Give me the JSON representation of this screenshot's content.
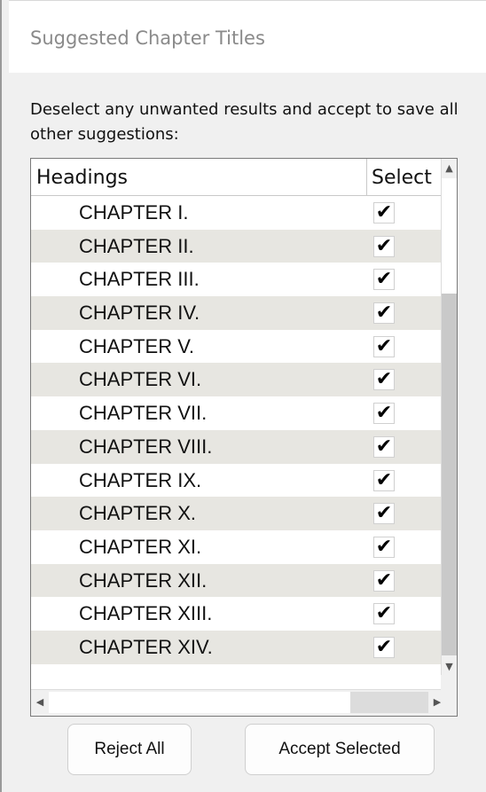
{
  "window": {
    "title": "Suggested Chapter Titles"
  },
  "instructions": "Deselect any unwanted results and accept to save all other suggestions:",
  "table": {
    "columns": {
      "headings": "Headings",
      "select": "Select"
    },
    "rows": [
      {
        "label": "CHAPTER I.",
        "checked": true
      },
      {
        "label": "CHAPTER II.",
        "checked": true
      },
      {
        "label": "CHAPTER III.",
        "checked": true
      },
      {
        "label": "CHAPTER IV.",
        "checked": true
      },
      {
        "label": "CHAPTER V.",
        "checked": true
      },
      {
        "label": "CHAPTER VI.",
        "checked": true
      },
      {
        "label": "CHAPTER VII.",
        "checked": true
      },
      {
        "label": "CHAPTER VIII.",
        "checked": true
      },
      {
        "label": "CHAPTER IX.",
        "checked": true
      },
      {
        "label": "CHAPTER X.",
        "checked": true
      },
      {
        "label": "CHAPTER XI.",
        "checked": true
      },
      {
        "label": "CHAPTER XII.",
        "checked": true
      },
      {
        "label": "CHAPTER XIII.",
        "checked": true
      },
      {
        "label": "CHAPTER XIV.",
        "checked": true
      }
    ],
    "checkmark_glyph": "✔"
  },
  "buttons": {
    "reject": "Reject All",
    "accept": "Accept Selected"
  },
  "colors": {
    "alt_row": "#e7e6e1",
    "title_text": "#8a8a8a"
  }
}
